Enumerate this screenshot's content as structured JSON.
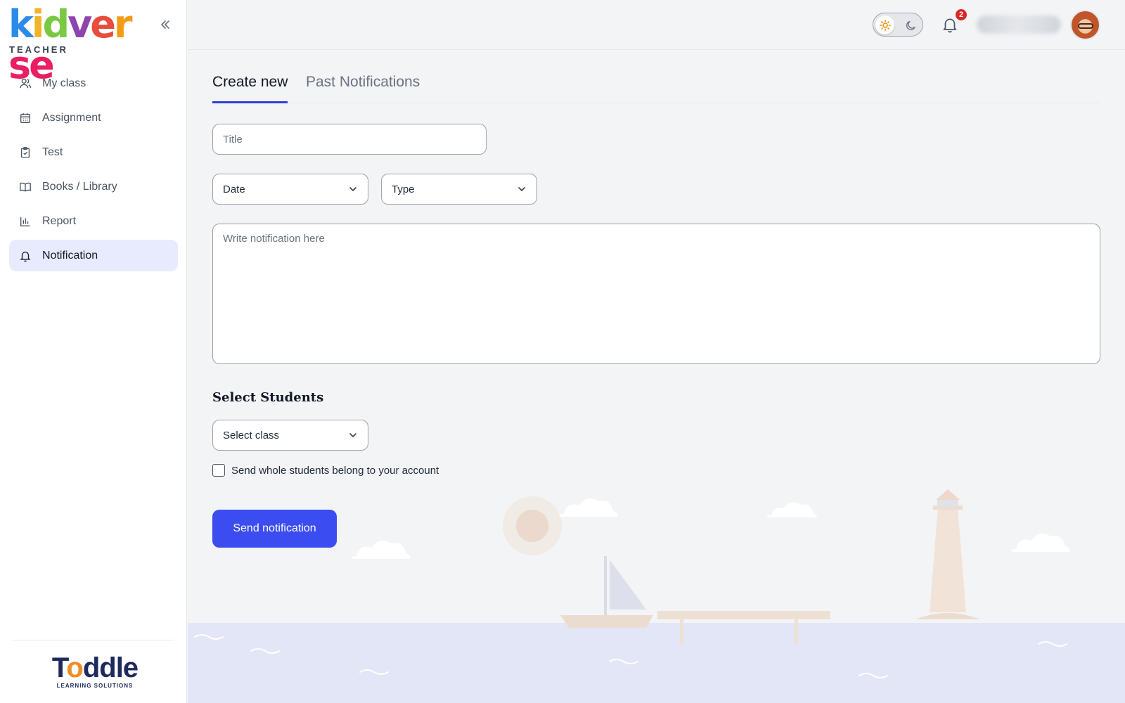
{
  "brand": {
    "logo_letters": [
      "k",
      "i",
      "d",
      "v",
      "e",
      "r",
      "s",
      "e"
    ],
    "logo_colors": [
      "#2b8be8",
      "#f0b429",
      "#7ac943",
      "#8e44ad",
      "#e74c3c",
      "#f39c12",
      "#e91e63",
      "#e91e63"
    ],
    "subtitle": "TEACHER",
    "footer_logo_pre": "T",
    "footer_logo_o": "o",
    "footer_logo_post": "ddle",
    "footer_sub": "LEARNING SOLUTIONS"
  },
  "sidebar": {
    "collapse_icon": "double-chevron-left-icon",
    "items": [
      {
        "label": "My class",
        "icon": "users-icon",
        "active": false
      },
      {
        "label": "Assignment",
        "icon": "calendar-icon",
        "active": false
      },
      {
        "label": "Test",
        "icon": "clipboard-check-icon",
        "active": false
      },
      {
        "label": "Books / Library",
        "icon": "book-open-icon",
        "active": false
      },
      {
        "label": "Report",
        "icon": "bar-chart-icon",
        "active": false
      },
      {
        "label": "Notification",
        "icon": "bell-icon",
        "active": true
      }
    ]
  },
  "header": {
    "theme": "light",
    "notification_count": "2"
  },
  "tabs": [
    {
      "label": "Create new",
      "active": true
    },
    {
      "label": "Past Notifications",
      "active": false
    }
  ],
  "form": {
    "title_placeholder": "Title",
    "date_label": "Date",
    "type_label": "Type",
    "message_placeholder": "Write notification here",
    "section_title": "Select Students",
    "class_label": "Select class",
    "checkbox_label": "Send whole students belong to your account",
    "checkbox_checked": false,
    "submit_label": "Send notification"
  },
  "colors": {
    "accent": "#3b4cf0",
    "active_nav_bg": "#e8ebfd",
    "tab_underline": "#2f3fd6",
    "badge": "#dc2626"
  }
}
